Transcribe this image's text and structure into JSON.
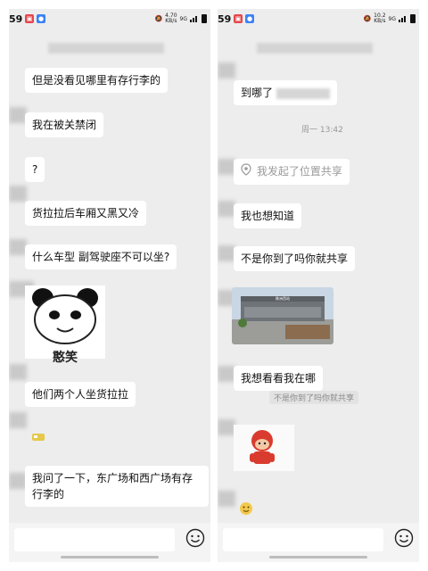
{
  "left": {
    "status": {
      "time": "59",
      "speed": "4.70\nKB/s",
      "network": "9G"
    },
    "messages": [
      {
        "text": "但是没看见哪里有存行李的"
      },
      {
        "text": "我在被关禁闭"
      },
      {
        "text": "?"
      },
      {
        "text": "货拉拉后车厢又黑又冷"
      },
      {
        "text": "什么车型 副驾驶座不可以坐?"
      },
      {
        "text": "他们两个人坐货拉拉"
      },
      {
        "text": "我问了一下，东广场和西广场有存行李的"
      }
    ],
    "sticker_caption": "憨笑"
  },
  "right": {
    "status": {
      "time": "59",
      "speed": "10.2\nKB/s",
      "network": "9G"
    },
    "messages": [
      {
        "text": "到哪了"
      },
      {
        "text": "我发起了位置共享"
      },
      {
        "text": "我也想知道"
      },
      {
        "text": "不是你到了吗你就共享"
      },
      {
        "text": "我想看看我在哪"
      }
    ],
    "timestamp": "周一 13:42",
    "quote": "不是你到了吗你就共享",
    "photo_sign": "株洲西站"
  },
  "icons": {
    "emoji": "smiley-icon",
    "location": "location-pin-icon"
  },
  "colors": {
    "chat_bg": "#ededed",
    "bubble": "#ffffff",
    "badge_red": "#e5474d",
    "badge_blue": "#3b82f6"
  }
}
